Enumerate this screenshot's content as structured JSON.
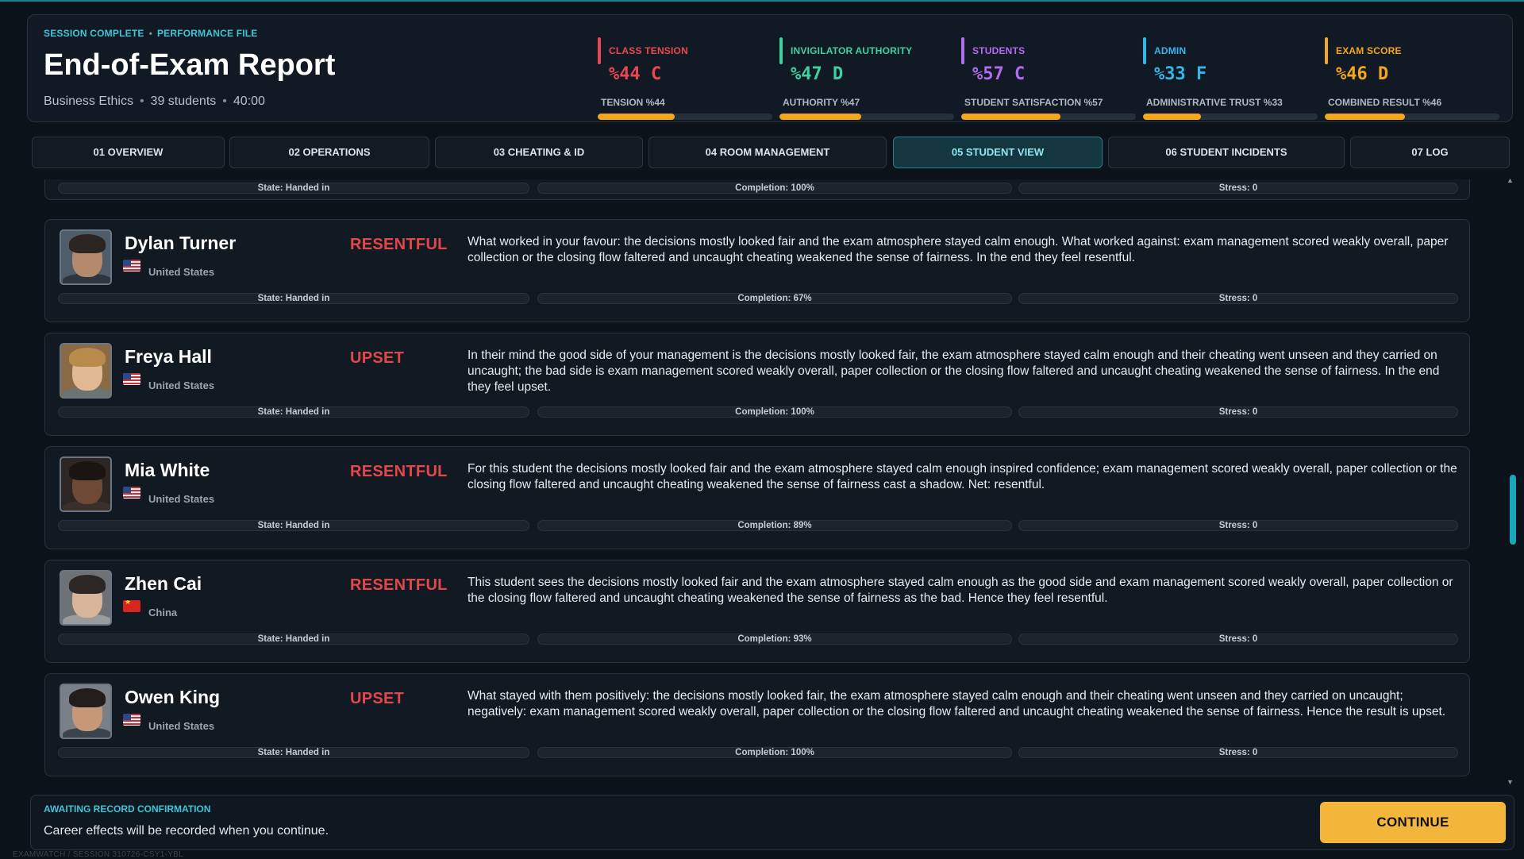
{
  "header": {
    "kicker_left": "SESSION COMPLETE",
    "kicker_right": "PERFORMANCE FILE",
    "title": "End-of-Exam Report",
    "subject": "Business Ethics",
    "students": "39 students",
    "time": "40:00"
  },
  "metrics": [
    {
      "label": "CLASS TENSION",
      "value": "%44 C",
      "sub": "TENSION %44",
      "fill_percent": 44,
      "accent": "#e8484f"
    },
    {
      "label": "INVIGILATOR AUTHORITY",
      "value": "%47 D",
      "sub": "AUTHORITY %47",
      "fill_percent": 47,
      "accent": "#3fd1a0"
    },
    {
      "label": "STUDENTS",
      "value": "%57 C",
      "sub": "STUDENT SATISFACTION %57",
      "fill_percent": 57,
      "accent": "#b36cf0"
    },
    {
      "label": "ADMIN",
      "value": "%33 F",
      "sub": "ADMINISTRATIVE TRUST %33",
      "fill_percent": 33,
      "accent": "#36b6e8"
    },
    {
      "label": "EXAM SCORE",
      "value": "%46 D",
      "sub": "COMBINED RESULT %46",
      "fill_percent": 46,
      "accent": "#f4a61c"
    }
  ],
  "tabs": [
    {
      "label": "01 OVERVIEW"
    },
    {
      "label": "02 OPERATIONS"
    },
    {
      "label": "03 CHEATING & ID"
    },
    {
      "label": "04 ROOM MANAGEMENT"
    },
    {
      "label": "05 STUDENT VIEW",
      "active": true
    },
    {
      "label": "06 STUDENT INCIDENTS"
    },
    {
      "label": "07 LOG"
    }
  ],
  "previous_row": {
    "state": "State: Handed in",
    "completion": "Completion: 100%",
    "stress": "Stress: 0"
  },
  "students": [
    {
      "name": "Dylan Turner",
      "country": "United States",
      "flag": "us",
      "mood": "RESENTFUL",
      "text": "What worked in your favour: the decisions mostly looked fair and the exam atmosphere stayed calm enough. What worked against: exam management scored weakly overall, paper collection or the closing flow faltered and uncaught cheating weakened the sense of fairness. In the end they feel resentful.",
      "state": "State: Handed in",
      "completion": "Completion: 67%",
      "stress": "Stress: 0"
    },
    {
      "name": "Freya Hall",
      "country": "United States",
      "flag": "us",
      "mood": "UPSET",
      "text": "In their mind the good side of your management is the decisions mostly looked fair, the exam atmosphere stayed calm enough and their cheating went unseen and they carried on uncaught; the bad side is exam management scored weakly overall, paper collection or the closing flow faltered and uncaught cheating weakened the sense of fairness. In the end they feel upset.",
      "state": "State: Handed in",
      "completion": "Completion: 100%",
      "stress": "Stress: 0"
    },
    {
      "name": "Mia White",
      "country": "United States",
      "flag": "us",
      "mood": "RESENTFUL",
      "text": "For this student the decisions mostly looked fair and the exam atmosphere stayed calm enough inspired confidence; exam management scored weakly overall, paper collection or the closing flow faltered and uncaught cheating weakened the sense of fairness cast a shadow. Net: resentful.",
      "state": "State: Handed in",
      "completion": "Completion: 89%",
      "stress": "Stress: 0"
    },
    {
      "name": "Zhen Cai",
      "country": "China",
      "flag": "cn",
      "mood": "RESENTFUL",
      "text": "This student sees the decisions mostly looked fair and the exam atmosphere stayed calm enough as the good side and exam management scored weakly overall, paper collection or the closing flow faltered and uncaught cheating weakened the sense of fairness as the bad. Hence they feel resentful.",
      "state": "State: Handed in",
      "completion": "Completion: 93%",
      "stress": "Stress: 0"
    },
    {
      "name": "Owen King",
      "country": "United States",
      "flag": "us",
      "mood": "UPSET",
      "text": "What stayed with them positively: the decisions mostly looked fair, the exam atmosphere stayed calm enough and their cheating went unseen and they carried on uncaught; negatively: exam management scored weakly overall, paper collection or the closing flow faltered and uncaught cheating weakened the sense of fairness. Hence the result is upset.",
      "state": "State: Handed in",
      "completion": "Completion: 100%",
      "stress": "Stress: 0"
    }
  ],
  "footer": {
    "kicker": "AWAITING RECORD CONFIRMATION",
    "message": "Career effects will be recorded when you continue.",
    "continue_label": "CONTINUE",
    "session_id": "EXAMWATCH / SESSION 310726-CSY1-YBL"
  }
}
